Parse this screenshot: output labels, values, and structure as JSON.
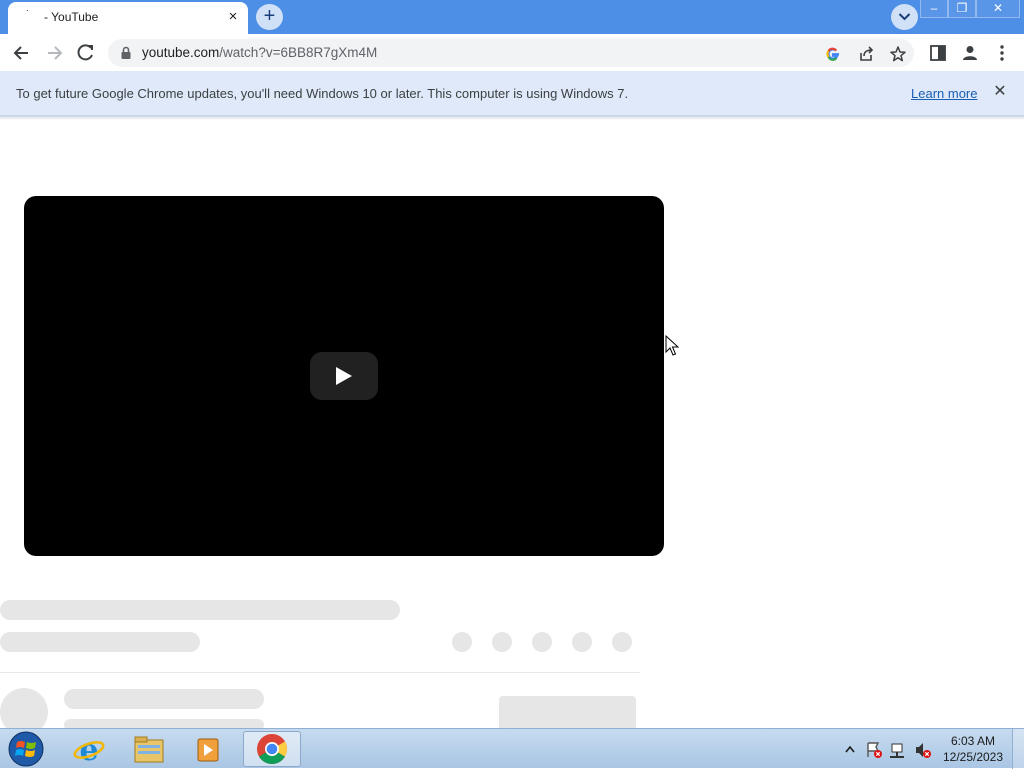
{
  "browser": {
    "tab": {
      "favicon": "loading-dots",
      "title": "- YouTube",
      "close": "×"
    },
    "new_tab": "+",
    "window_controls": {
      "minimize": "–",
      "restore": "❐",
      "close": "✕"
    },
    "url": {
      "host": "youtube.com",
      "path": "/watch?v=6BB8R7gXm4M"
    },
    "toolbar_icons": [
      "back-arrow-icon",
      "forward-arrow-icon",
      "stop-loading-icon",
      "lock-icon",
      "google-lens-icon",
      "share-icon",
      "bookmark-star-icon",
      "side-panel-icon",
      "profile-icon",
      "more-menu-icon"
    ]
  },
  "infobar": {
    "message": "To get future Google Chrome updates, you'll need Windows 10 or later. This computer is using Windows 7.",
    "link": "Learn more",
    "close": "✕"
  },
  "player": {
    "state": "loading",
    "play_icon": "play-icon"
  },
  "taskbar": {
    "apps": [
      "internet-explorer-icon",
      "file-explorer-icon",
      "media-player-icon",
      "chrome-icon"
    ],
    "active_app": "chrome-icon",
    "tray_icons": [
      "show-hidden-icons-icon",
      "action-center-flag-icon",
      "network-icon",
      "volume-muted-icon"
    ],
    "time": "6:03 AM",
    "date": "12/25/2023"
  },
  "colors": {
    "title_bar": "#4d8ee6",
    "infobar": "#dfe9f9",
    "link": "#1a5fb4",
    "skeleton": "#e6e6e6",
    "player": "#000000"
  }
}
